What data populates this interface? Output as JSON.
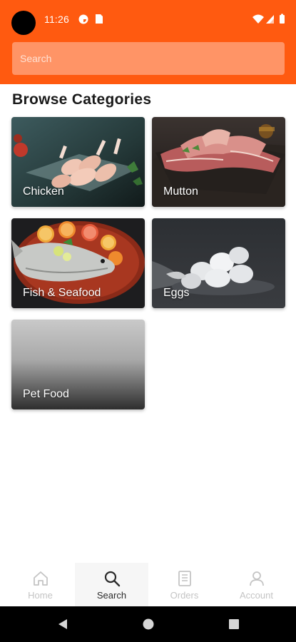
{
  "status_bar": {
    "time": "11:26",
    "icons": [
      "camera-cutout",
      "vpn-icon",
      "sim-card-icon",
      "wifi-icon",
      "signal-icon",
      "battery-icon"
    ]
  },
  "search": {
    "placeholder": "Search"
  },
  "section": {
    "title": "Browse Categories"
  },
  "categories": [
    {
      "label": "Chicken"
    },
    {
      "label": "Mutton"
    },
    {
      "label": "Fish & Seafood"
    },
    {
      "label": "Eggs"
    },
    {
      "label": "Pet Food"
    }
  ],
  "bottom_nav": {
    "items": [
      {
        "label": "Home",
        "icon": "home-icon",
        "active": false
      },
      {
        "label": "Search",
        "icon": "search-icon",
        "active": true
      },
      {
        "label": "Orders",
        "icon": "orders-icon",
        "active": false
      },
      {
        "label": "Account",
        "icon": "account-icon",
        "active": false
      }
    ]
  },
  "colors": {
    "header": "#ff5a10",
    "search_field": "#ff9466",
    "active_nav": "#2a2a2a",
    "inactive_nav": "#c4c4c4"
  }
}
